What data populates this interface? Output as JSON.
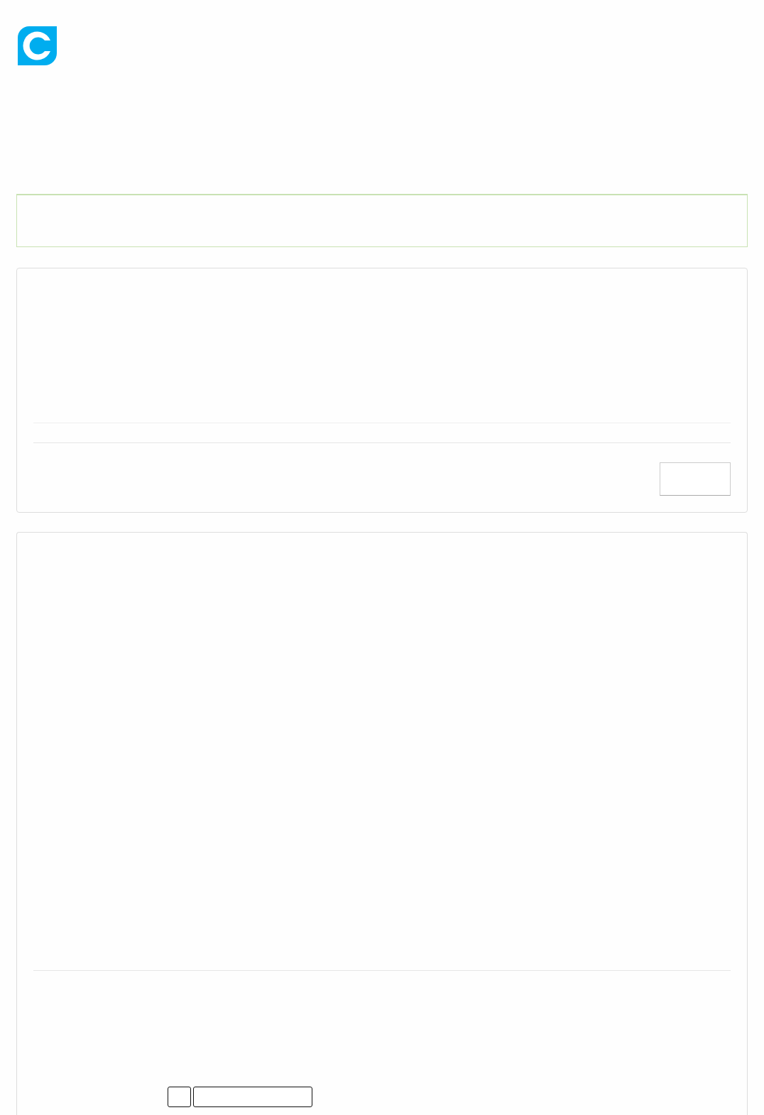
{
  "logo": {
    "kind": "mark"
  },
  "alert": {
    "kind": "success"
  },
  "cards": [
    {
      "kind": "actions"
    },
    {
      "kind": "inputs"
    }
  ]
}
